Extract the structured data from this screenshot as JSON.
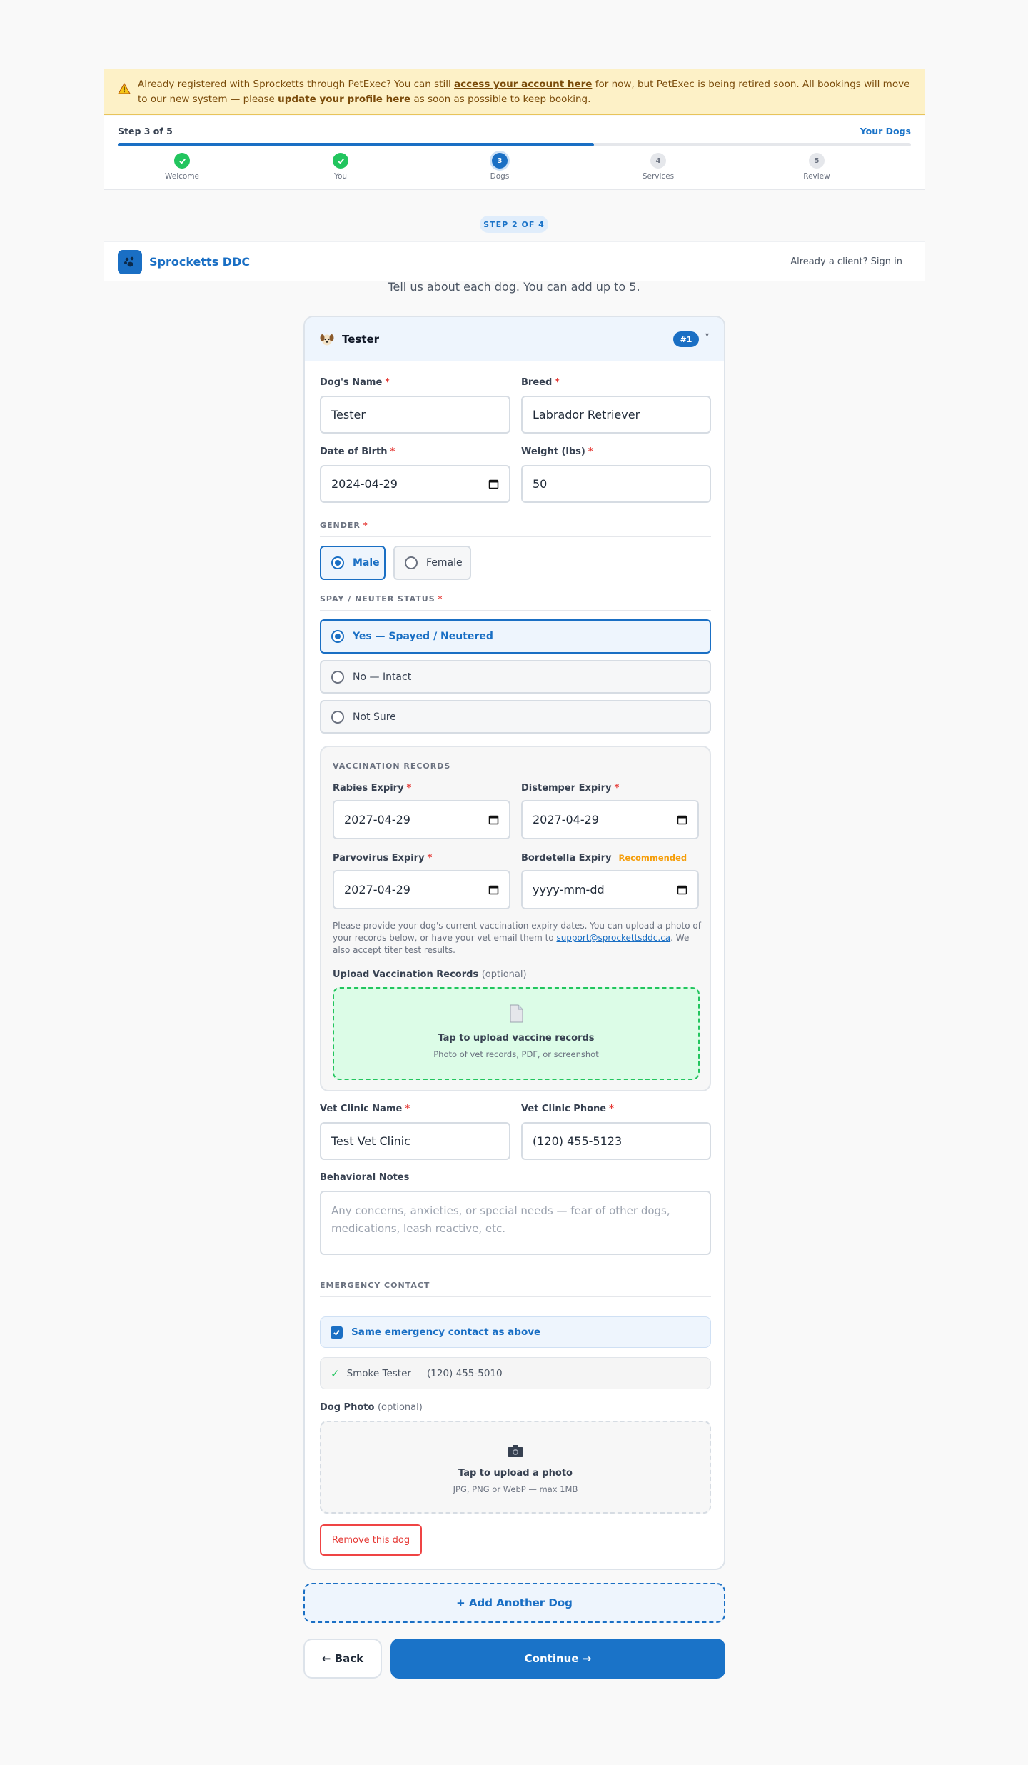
{
  "banner": {
    "text_pre": "Already registered with Sprocketts through PetExec? You can still ",
    "link_access": "access your account here",
    "text_mid": " for now, but PetExec is being retired soon. All bookings will move to our new system — please ",
    "link_update": "update your profile here",
    "text_post": " as soon as possible to keep booking."
  },
  "stepper": {
    "label": "Step 3 of 5",
    "current_name": "Your Dogs",
    "progress_percent": 60,
    "steps": [
      {
        "num": "1",
        "label": "Welcome",
        "state": "done"
      },
      {
        "num": "2",
        "label": "You",
        "state": "done"
      },
      {
        "num": "3",
        "label": "Dogs",
        "state": "current"
      },
      {
        "num": "4",
        "label": "Services",
        "state": "todo"
      },
      {
        "num": "5",
        "label": "Review",
        "state": "todo"
      }
    ]
  },
  "substep_pill": "STEP 2 OF 4",
  "header": {
    "brand": "Sprocketts DDC",
    "signin": "Already a client? Sign in"
  },
  "intro": "Tell us about each dog. You can add up to 5.",
  "dog_card": {
    "title": "Tester",
    "badge": "#1",
    "chevron": "▾",
    "name_label": "Dog's Name",
    "name_value": "Tester",
    "breed_label": "Breed",
    "breed_value": "Labrador Retriever",
    "dob_label": "Date of Birth",
    "dob_value": "2024-04-29",
    "weight_label": "Weight (lbs)",
    "weight_value": "50",
    "required_mark": "*",
    "gender_title": "GENDER",
    "gender_options": [
      "Male",
      "Female"
    ],
    "gender_selected": "Male",
    "spay_title": "SPAY / NEUTER STATUS",
    "spay_options": [
      "Yes — Spayed / Neutered",
      "No — Intact",
      "Not Sure"
    ],
    "spay_selected": "Yes — Spayed / Neutered",
    "vacc": {
      "title": "VACCINATION RECORDS",
      "rabies_label": "Rabies Expiry",
      "rabies_value": "2027-04-29",
      "distemper_label": "Distemper Expiry",
      "distemper_value": "2027-04-29",
      "parvo_label": "Parvovirus Expiry",
      "parvo_value": "2027-04-29",
      "bordetella_label": "Bordetella Expiry",
      "bordetella_tag": "Recommended",
      "bordetella_placeholder": "yyyy-mm-dd",
      "help_pre": "Please provide your dog's current vaccination expiry dates. You can upload a photo of your records below, or have your vet email them to ",
      "help_email": "support@sprockettsddc.ca",
      "help_post": ". We also accept titer test results.",
      "upload_label": "Upload Vaccination Records",
      "upload_optional": "(optional)",
      "upload_title": "Tap to upload vaccine records",
      "upload_sub": "Photo of vet records, PDF, or screenshot"
    },
    "vet_name_label": "Vet Clinic Name",
    "vet_name_value": "Test Vet Clinic",
    "vet_phone_label": "Vet Clinic Phone",
    "vet_phone_value": "(120) 455-5123",
    "notes_label": "Behavioral Notes",
    "notes_placeholder": "Any concerns, anxieties, or special needs — fear of other dogs, medications, leash reactive, etc.",
    "emergency_title": "EMERGENCY CONTACT",
    "same_contact_label": "Same emergency contact as above",
    "same_contact_checked": true,
    "contact_summary": "Smoke Tester — (120) 455-5010",
    "photo_label": "Dog Photo",
    "photo_optional": "(optional)",
    "photo_title": "Tap to upload a photo",
    "photo_sub": "JPG, PNG or WebP — max 1MB",
    "remove_label": "Remove this dog"
  },
  "add_dog": "+ Add Another Dog",
  "back": "← Back",
  "continue": "Continue →",
  "colors": {
    "primary": "#1a73c8",
    "success": "#22c55e",
    "warning_bg": "#fdf1c7",
    "danger": "#e53935"
  }
}
